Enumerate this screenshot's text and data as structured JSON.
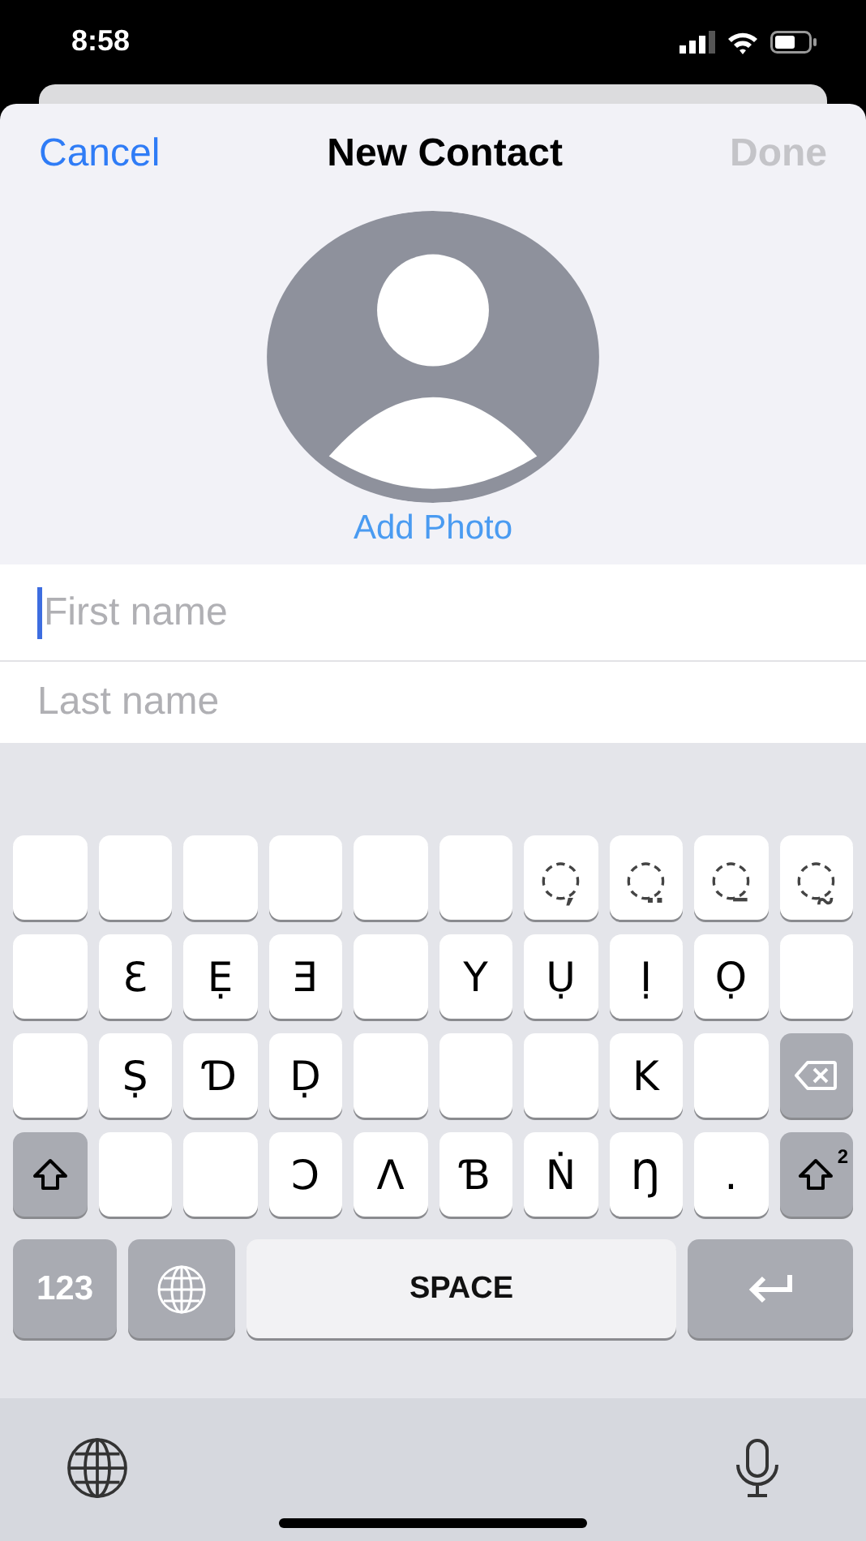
{
  "status_bar": {
    "time": "8:58"
  },
  "header": {
    "cancel": "Cancel",
    "title": "New Contact",
    "done": {
      "label": "Done",
      "disabled": true
    }
  },
  "photo": {
    "label": "Add Photo"
  },
  "fields": [
    {
      "placeholder": "First name",
      "focused": true
    },
    {
      "placeholder": "Last name",
      "focused": false
    }
  ],
  "keyboard": {
    "rows": [
      [
        {
          "kind": "blank"
        },
        {
          "kind": "blank"
        },
        {
          "kind": "blank"
        },
        {
          "kind": "blank"
        },
        {
          "kind": "blank"
        },
        {
          "kind": "blank"
        },
        {
          "kind": "mark",
          "label": "◌̦"
        },
        {
          "kind": "mark",
          "label": "◌̤"
        },
        {
          "kind": "mark",
          "label": "◌̱"
        },
        {
          "kind": "mark",
          "label": "◌̰"
        }
      ],
      [
        {
          "kind": "blank"
        },
        {
          "kind": "char",
          "label": "Ɛ"
        },
        {
          "kind": "char",
          "label": "Ẹ"
        },
        {
          "kind": "char",
          "label": "Ǝ"
        },
        {
          "kind": "blank"
        },
        {
          "kind": "char",
          "label": "Y"
        },
        {
          "kind": "char",
          "label": "Ụ"
        },
        {
          "kind": "char",
          "label": "Ị"
        },
        {
          "kind": "char",
          "label": "Ọ"
        },
        {
          "kind": "blank"
        }
      ],
      [
        {
          "kind": "blank"
        },
        {
          "kind": "char",
          "label": "Ṣ"
        },
        {
          "kind": "char",
          "label": "Ɗ"
        },
        {
          "kind": "char",
          "label": "Ḍ"
        },
        {
          "kind": "blank"
        },
        {
          "kind": "blank"
        },
        {
          "kind": "blank"
        },
        {
          "kind": "char",
          "label": "K"
        },
        {
          "kind": "blank"
        },
        {
          "kind": "backspace"
        }
      ],
      [
        {
          "kind": "shift"
        },
        {
          "kind": "blank"
        },
        {
          "kind": "blank"
        },
        {
          "kind": "char",
          "label": "Ɔ"
        },
        {
          "kind": "char",
          "label": "Ʌ"
        },
        {
          "kind": "char",
          "label": "Ɓ"
        },
        {
          "kind": "char",
          "label": "Ṅ"
        },
        {
          "kind": "char",
          "label": "Ŋ"
        },
        {
          "kind": "char",
          "label": "."
        },
        {
          "kind": "shift2",
          "label": "2"
        }
      ]
    ],
    "bottom_row": {
      "numbers": "123",
      "space": "SPACE"
    }
  }
}
